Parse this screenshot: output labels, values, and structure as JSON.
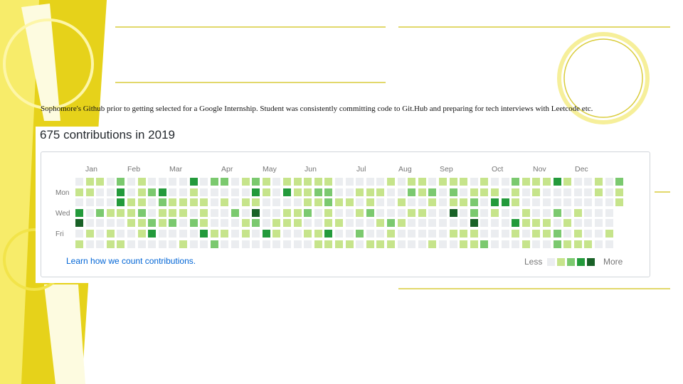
{
  "slide": {
    "caption": "Sophomore's Github prior to getting selected for a Google Internship. Student was consistently committing code to Git.Hub and preparing for tech interviews with Leetcode etc."
  },
  "contributions": {
    "title": "675 contributions in 2019",
    "months": [
      "Jan",
      "Feb",
      "Mar",
      "Apr",
      "May",
      "Jun",
      "Jul",
      "Aug",
      "Sep",
      "Oct",
      "Nov",
      "Dec"
    ],
    "day_labels": [
      "Mon",
      "Wed",
      "Fri"
    ],
    "learn_link": "Learn how we count contributions.",
    "legend_less": "Less",
    "legend_more": "More",
    "colors": [
      "#ebedf0",
      "#c6e48b",
      "#7bc96f",
      "#239a3b",
      "#196127"
    ]
  }
}
